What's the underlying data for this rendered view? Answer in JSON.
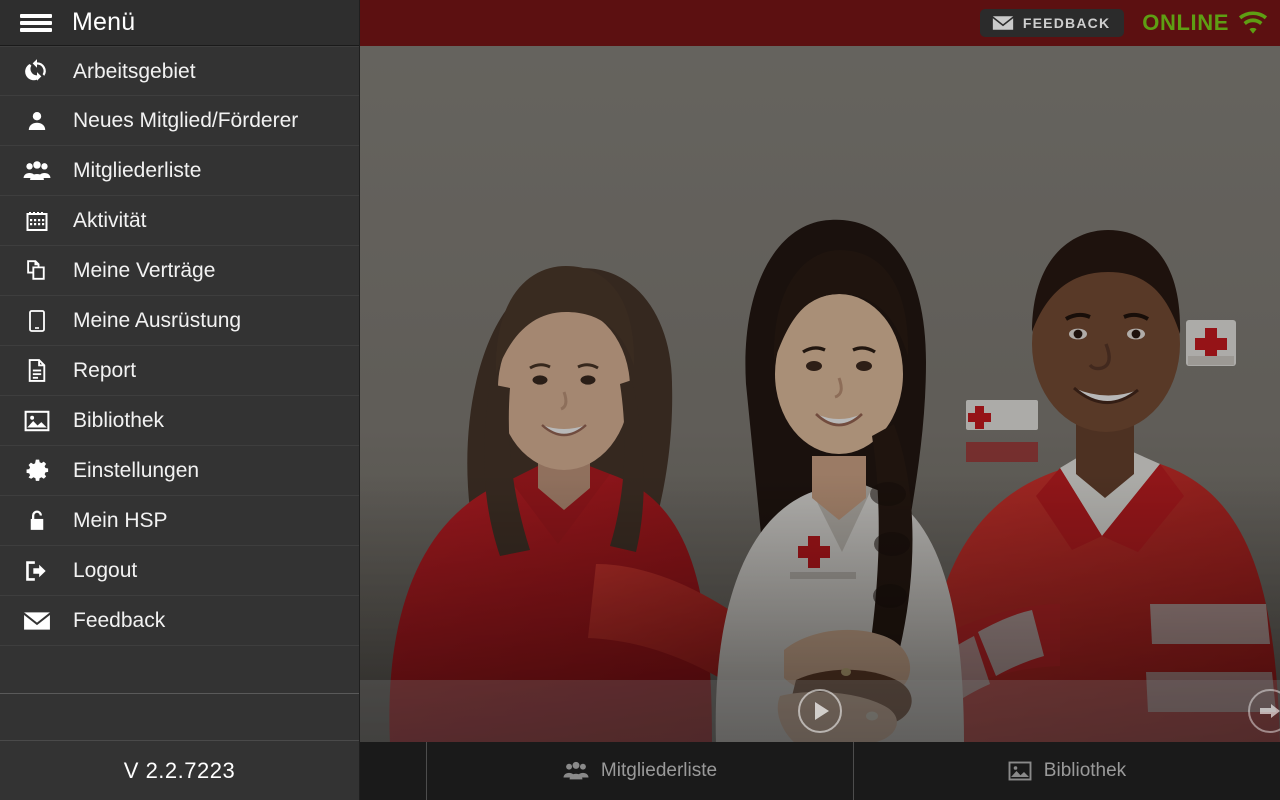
{
  "app": {
    "accent_red": "#5c1011",
    "sidebar_bg": "#333333",
    "online_green": "#5e9e13"
  },
  "sidebar": {
    "menu_icon": "hamburger-icon",
    "title": "Menü",
    "version": "V 2.2.7223",
    "items": [
      {
        "label": "Arbeitsgebiet",
        "icon": "refresh-icon"
      },
      {
        "label": "Neues Mitglied/Förderer",
        "icon": "user-icon"
      },
      {
        "label": "Mitgliederliste",
        "icon": "users-icon"
      },
      {
        "label": "Aktivität",
        "icon": "calendar-icon"
      },
      {
        "label": "Meine Verträge",
        "icon": "copy-documents-icon"
      },
      {
        "label": "Meine Ausrüstung",
        "icon": "tablet-icon"
      },
      {
        "label": "Report",
        "icon": "document-lines-icon"
      },
      {
        "label": "Bibliothek",
        "icon": "image-icon"
      },
      {
        "label": "Einstellungen",
        "icon": "gear-icon"
      },
      {
        "label": "Mein HSP",
        "icon": "lock-icon"
      },
      {
        "label": "Logout",
        "icon": "logout-icon"
      },
      {
        "label": "Feedback",
        "icon": "envelope-icon"
      }
    ]
  },
  "topbar": {
    "feedback_label": "FEEDBACK",
    "feedback_icon": "envelope-icon",
    "status_label": "ONLINE",
    "status_icon": "wifi-icon"
  },
  "hero": {
    "play_icon": "play-icon",
    "next_icon": "chevron-right-icon",
    "alt": "Drei Rotkreuz-Helfer legen ihre Hände übereinander"
  },
  "bottombar": {
    "tabs": [
      {
        "label": "Mitgliederliste",
        "icon": "users-icon"
      },
      {
        "label": "Bibliothek",
        "icon": "image-icon"
      }
    ]
  }
}
